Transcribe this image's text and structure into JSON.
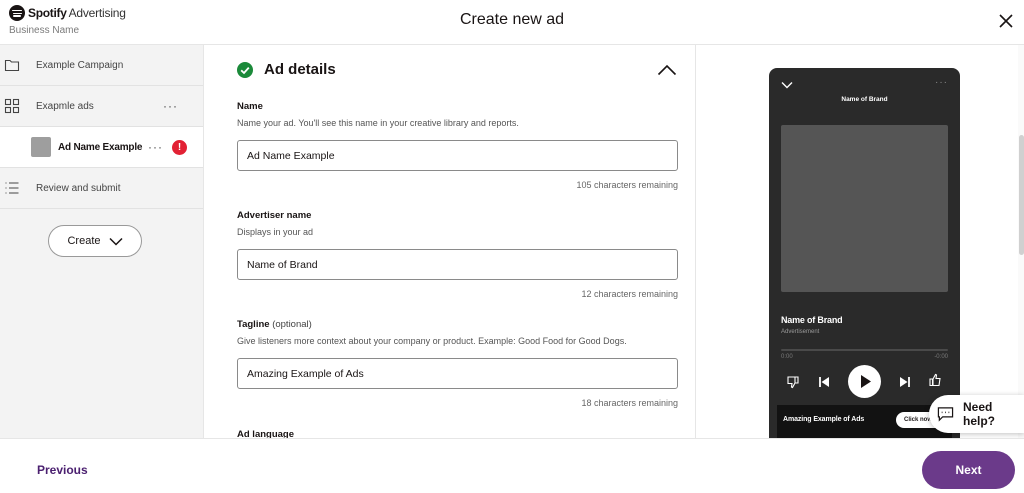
{
  "header": {
    "brand_name": "Spotify",
    "brand_product": "Advertising",
    "business_name": "Business Name",
    "title": "Create new ad"
  },
  "sidebar": {
    "items": [
      {
        "label": "Example Campaign",
        "icon": "folder-icon"
      },
      {
        "label": "Exapmle ads",
        "icon": "grid-icon"
      },
      {
        "label": "Ad Name Example",
        "icon": "ad-thumbnail",
        "status": "error"
      },
      {
        "label": "Review and submit",
        "icon": "list-icon"
      }
    ],
    "more_glyph": "···",
    "error_glyph": "!",
    "create_label": "Create"
  },
  "form": {
    "section_title": "Ad details",
    "name": {
      "label": "Name",
      "help": "Name your ad. You'll see this name in your creative library and reports.",
      "value": "Ad Name Example",
      "remaining": "105 characters remaining"
    },
    "advertiser": {
      "label": "Advertiser name",
      "help": "Displays in your ad",
      "value": "Name of Brand",
      "remaining": "12 characters remaining"
    },
    "tagline": {
      "label": "Tagline",
      "optional": "(optional)",
      "help": "Give listeners more context about your company or product. Example: Good Food for Good Dogs.",
      "value": "Amazing Example of Ads",
      "remaining": "18 characters remaining"
    },
    "language": {
      "label": "Ad language"
    }
  },
  "preview": {
    "header_title": "Name of Brand",
    "brand": "Name of Brand",
    "sub": "Advertisement",
    "time_start": "0:00",
    "time_end": "-0:00",
    "banner_text": "Amazing Example of Ads",
    "banner_button": "Click now",
    "more_glyph": "···",
    "colors": {
      "phone_bg": "#2a2a2a",
      "artwork": "#555555",
      "banner_bg": "#121212"
    }
  },
  "help_widget": {
    "label": "Need help?"
  },
  "footer": {
    "previous_label": "Previous",
    "next_label": "Next"
  },
  "colors": {
    "accent_purple": "#6b3a8a",
    "previous_purple": "#4b2070",
    "success_green": "#1b8a3a",
    "error_red": "#e22134"
  }
}
